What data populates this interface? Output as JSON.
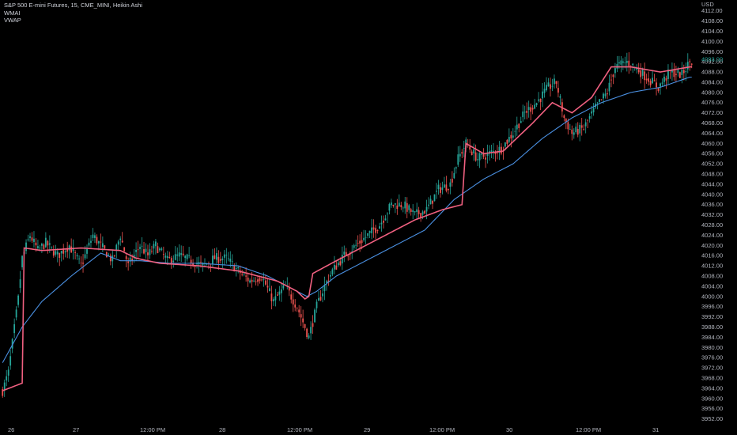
{
  "legend": {
    "symbol_line": "S&P 500 E-mini Futures, 15, CME_MINI, Heikin Ashi",
    "indicator_1": "WMAI",
    "indicator_2": "VWAP"
  },
  "chart_data": {
    "type": "candlestick",
    "title": "S&P 500 E-mini Futures, 15, CME_MINI, Heikin Ashi",
    "currency": "USD",
    "ylim": [
      3950,
      4115
    ],
    "y_ticks": [
      3952,
      3956,
      3960,
      3964,
      3968,
      3972,
      3976,
      3980,
      3984,
      3988,
      3992,
      3996,
      4000,
      4004,
      4008,
      4012,
      4016,
      4020,
      4024,
      4028,
      4032,
      4036,
      4040,
      4044,
      4048,
      4052,
      4056,
      4060,
      4064,
      4068,
      4072,
      4076,
      4080,
      4084,
      4088,
      4092,
      4096,
      4100,
      4104,
      4108,
      4112
    ],
    "x_ticks": [
      "26",
      "27",
      "12:00 PM",
      "28",
      "12:00 PM",
      "29",
      "12:00 PM",
      "30",
      "12:00 PM",
      "31"
    ],
    "last_price": "4093.00",
    "colors": {
      "up": "#26a69a",
      "down": "#ef5350",
      "wmai": "#f06080",
      "vwap": "#4a90e2",
      "axis_text": "#b2b5be"
    },
    "candle_keypoints": [
      [
        0,
        3963
      ],
      [
        3,
        3970
      ],
      [
        8,
        3999
      ],
      [
        10,
        4015
      ],
      [
        14,
        4024
      ],
      [
        18,
        4018
      ],
      [
        22,
        4021
      ],
      [
        28,
        4016
      ],
      [
        34,
        4020
      ],
      [
        40,
        4012
      ],
      [
        46,
        4024
      ],
      [
        50,
        4020
      ],
      [
        56,
        4014
      ],
      [
        60,
        4024
      ],
      [
        64,
        4012
      ],
      [
        70,
        4020
      ],
      [
        74,
        4016
      ],
      [
        78,
        4020
      ],
      [
        84,
        4014
      ],
      [
        90,
        4016
      ],
      [
        96,
        4014
      ],
      [
        102,
        4012
      ],
      [
        108,
        4015
      ],
      [
        114,
        4015
      ],
      [
        120,
        4010
      ],
      [
        126,
        4006
      ],
      [
        132,
        4008
      ],
      [
        138,
        3998
      ],
      [
        144,
        4004
      ],
      [
        150,
        3996
      ],
      [
        156,
        3984
      ],
      [
        160,
        3996
      ],
      [
        164,
        4004
      ],
      [
        168,
        4010
      ],
      [
        174,
        4016
      ],
      [
        180,
        4020
      ],
      [
        186,
        4024
      ],
      [
        192,
        4028
      ],
      [
        198,
        4036
      ],
      [
        204,
        4036
      ],
      [
        210,
        4032
      ],
      [
        216,
        4034
      ],
      [
        222,
        4042
      ],
      [
        228,
        4044
      ],
      [
        232,
        4054
      ],
      [
        236,
        4060
      ],
      [
        242,
        4054
      ],
      [
        248,
        4056
      ],
      [
        254,
        4058
      ],
      [
        260,
        4064
      ],
      [
        266,
        4072
      ],
      [
        272,
        4076
      ],
      [
        278,
        4082
      ],
      [
        282,
        4084
      ],
      [
        286,
        4070
      ],
      [
        290,
        4064
      ],
      [
        296,
        4066
      ],
      [
        302,
        4074
      ],
      [
        308,
        4080
      ],
      [
        312,
        4090
      ],
      [
        318,
        4092
      ],
      [
        322,
        4090
      ],
      [
        328,
        4086
      ],
      [
        334,
        4082
      ],
      [
        340,
        4088
      ],
      [
        346,
        4087
      ],
      [
        350,
        4092
      ]
    ],
    "wmai_keypoints": [
      [
        0,
        3963
      ],
      [
        10,
        3966
      ],
      [
        11,
        4019
      ],
      [
        20,
        4018
      ],
      [
        40,
        4019
      ],
      [
        60,
        4018
      ],
      [
        68,
        4015
      ],
      [
        80,
        4013
      ],
      [
        100,
        4012
      ],
      [
        120,
        4010
      ],
      [
        140,
        4006
      ],
      [
        150,
        4002
      ],
      [
        154,
        3999
      ],
      [
        156,
        4000
      ],
      [
        158,
        4009
      ],
      [
        170,
        4014
      ],
      [
        180,
        4018
      ],
      [
        195,
        4024
      ],
      [
        210,
        4030
      ],
      [
        224,
        4034
      ],
      [
        234,
        4036
      ],
      [
        236,
        4060
      ],
      [
        245,
        4056
      ],
      [
        255,
        4057
      ],
      [
        270,
        4068
      ],
      [
        280,
        4076
      ],
      [
        290,
        4072
      ],
      [
        300,
        4078
      ],
      [
        310,
        4090
      ],
      [
        320,
        4090
      ],
      [
        335,
        4088
      ],
      [
        350,
        4090
      ]
    ],
    "vwap_keypoints": [
      [
        0,
        3974
      ],
      [
        10,
        3988
      ],
      [
        20,
        3998
      ],
      [
        35,
        4008
      ],
      [
        50,
        4017
      ],
      [
        60,
        4014
      ],
      [
        70,
        4014
      ],
      [
        85,
        4013
      ],
      [
        100,
        4013
      ],
      [
        120,
        4012
      ],
      [
        135,
        4008
      ],
      [
        145,
        4004
      ],
      [
        155,
        4000
      ],
      [
        160,
        4002
      ],
      [
        170,
        4008
      ],
      [
        185,
        4014
      ],
      [
        200,
        4020
      ],
      [
        215,
        4026
      ],
      [
        230,
        4038
      ],
      [
        245,
        4046
      ],
      [
        260,
        4052
      ],
      [
        275,
        4062
      ],
      [
        290,
        4070
      ],
      [
        305,
        4076
      ],
      [
        320,
        4080
      ],
      [
        335,
        4082
      ],
      [
        350,
        4086
      ]
    ]
  }
}
